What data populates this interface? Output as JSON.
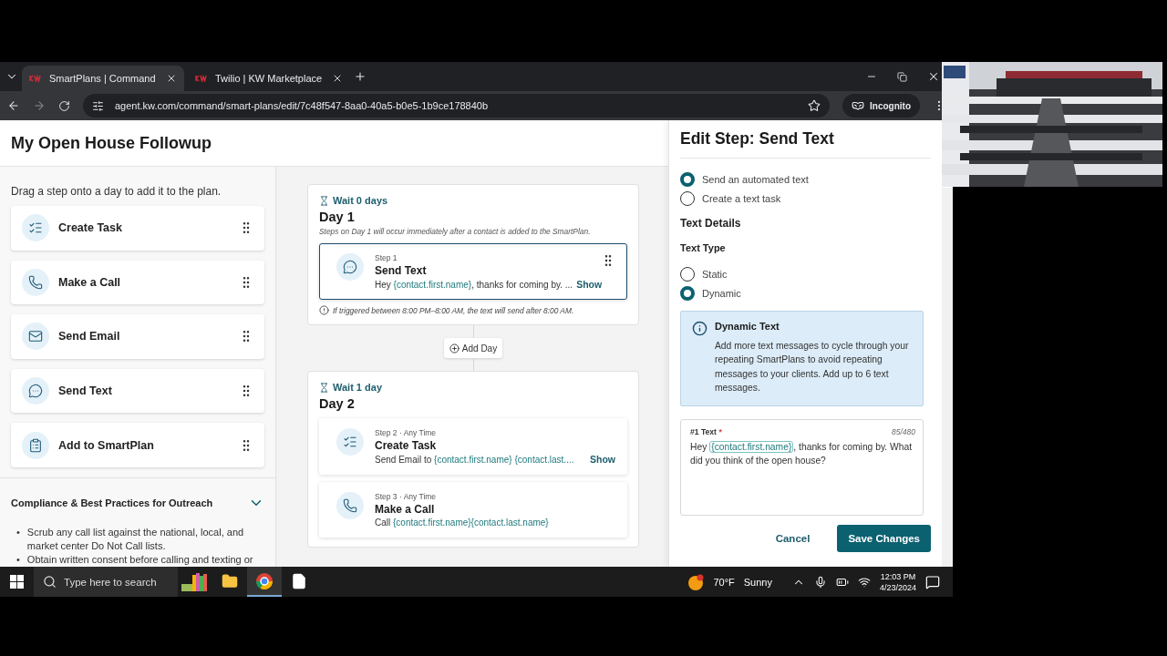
{
  "browser": {
    "tabs": [
      {
        "title": "SmartPlans | Command",
        "selected": true
      },
      {
        "title": "Twilio | KW Marketplace",
        "selected": false
      }
    ],
    "url": "agent.kw.com/command/smart-plans/edit/7c48f547-8aa0-40a5-b0e5-1b9ce178840b",
    "profile": "Incognito"
  },
  "page": {
    "title": "My Open House Followup"
  },
  "sidebar": {
    "hint": "Drag a step onto a day to add it to the plan.",
    "steps": [
      {
        "label": "Create Task",
        "kind": "task"
      },
      {
        "label": "Make a Call",
        "kind": "call"
      },
      {
        "label": "Send Email",
        "kind": "email"
      },
      {
        "label": "Send Text",
        "kind": "text"
      },
      {
        "label": "Add to SmartPlan",
        "kind": "plan"
      }
    ],
    "compliance": {
      "title": "Compliance & Best Practices for Outreach",
      "expanded": true,
      "bullets": [
        {
          "marker": "•",
          "text": "Scrub any call list against the national, local, and market center Do Not Call lists."
        },
        {
          "marker": "•",
          "text": "Obtain written consent before calling and texting or"
        }
      ]
    }
  },
  "plan": {
    "days": [
      {
        "wait": "Wait 0 days",
        "title": "Day 1",
        "note": "Steps on Day 1 will occur immediately after a contact is added to the SmartPlan.",
        "warning": "If triggered between 8:00 PM–8:00 AM, the text will send after 8:00 AM.",
        "steps": [
          {
            "kind": "text",
            "label": "Step 1",
            "title": "Send Text",
            "selected": true,
            "show": "Show",
            "preview": [
              {
                "kind": "plain",
                "text": "Hey "
              },
              {
                "kind": "token",
                "text": "{contact.first.name}"
              },
              {
                "kind": "plain",
                "text": ", thanks for coming by. ..."
              }
            ]
          }
        ]
      },
      {
        "wait": "Wait 1 day",
        "title": "Day 2",
        "steps": [
          {
            "kind": "task",
            "label": "Step 2 · Any Time",
            "title": "Create Task",
            "selected": false,
            "show": "Show",
            "preview": [
              {
                "kind": "plain",
                "text": "Send Email to "
              },
              {
                "kind": "token",
                "text": "{contact.first.name} {contact.last...."
              }
            ]
          },
          {
            "kind": "call",
            "label": "Step 3 · Any Time",
            "title": "Make a Call",
            "selected": false,
            "preview": [
              {
                "kind": "plain",
                "text": "Call "
              },
              {
                "kind": "token",
                "text": "{contact.first.name}{contact.last.name}"
              }
            ]
          }
        ]
      }
    ],
    "add_day": "Add Day"
  },
  "panel": {
    "title": "Edit Step: Send Text",
    "delivery": [
      {
        "label": "Send an automated text",
        "selected": true
      },
      {
        "label": "Create a text task",
        "selected": false
      }
    ],
    "section": "Text Details",
    "type_label": "Text Type",
    "types": [
      {
        "label": "Static",
        "selected": false
      },
      {
        "label": "Dynamic",
        "selected": true
      }
    ],
    "info": {
      "title": "Dynamic Text",
      "body": "Add more text messages to cycle through your repeating SmartPlans to avoid repeating messages to your clients. Add up to 6 text messages."
    },
    "message": {
      "label": "#1 Text",
      "required": "*",
      "counter": "85/480",
      "value": [
        {
          "kind": "plain",
          "text": "Hey "
        },
        {
          "kind": "token",
          "text": "{contact.first.name}"
        },
        {
          "kind": "plain",
          "text": ", thanks for coming by. What did you think of the open house?"
        }
      ]
    },
    "cancel": "Cancel",
    "save": "Save Changes"
  },
  "taskbar": {
    "search_placeholder": "Type here to search",
    "temperature": "70°F",
    "weather": "Sunny",
    "time": "12:03 PM",
    "date": "4/23/2024"
  }
}
